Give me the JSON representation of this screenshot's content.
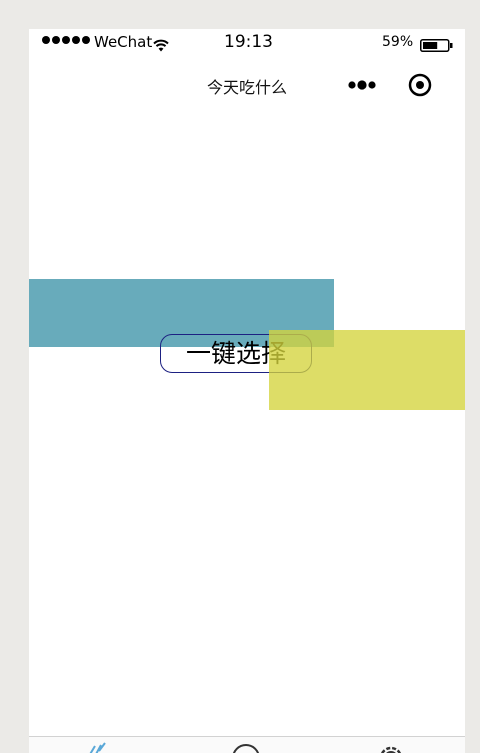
{
  "status_bar": {
    "carrier": "WeChat",
    "time": "19:13",
    "battery": "59%",
    "battery_level": 0.59
  },
  "nav": {
    "title": "今天吃什么",
    "menu_icon": "more-dots-icon",
    "close_icon": "capsule-close-icon"
  },
  "main": {
    "pick_button_label": "一键选择"
  },
  "colors": {
    "teal_block": "#68abbb",
    "yellow_block": "#d4d43c",
    "button_border": "#1d2182",
    "tab_active": "#5aa8d8"
  },
  "tab_bar": {
    "tabs": [
      {
        "icon": "food-icon",
        "active": true
      },
      {
        "icon": "circle-icon",
        "active": false
      },
      {
        "icon": "gear-icon",
        "active": false
      }
    ]
  }
}
